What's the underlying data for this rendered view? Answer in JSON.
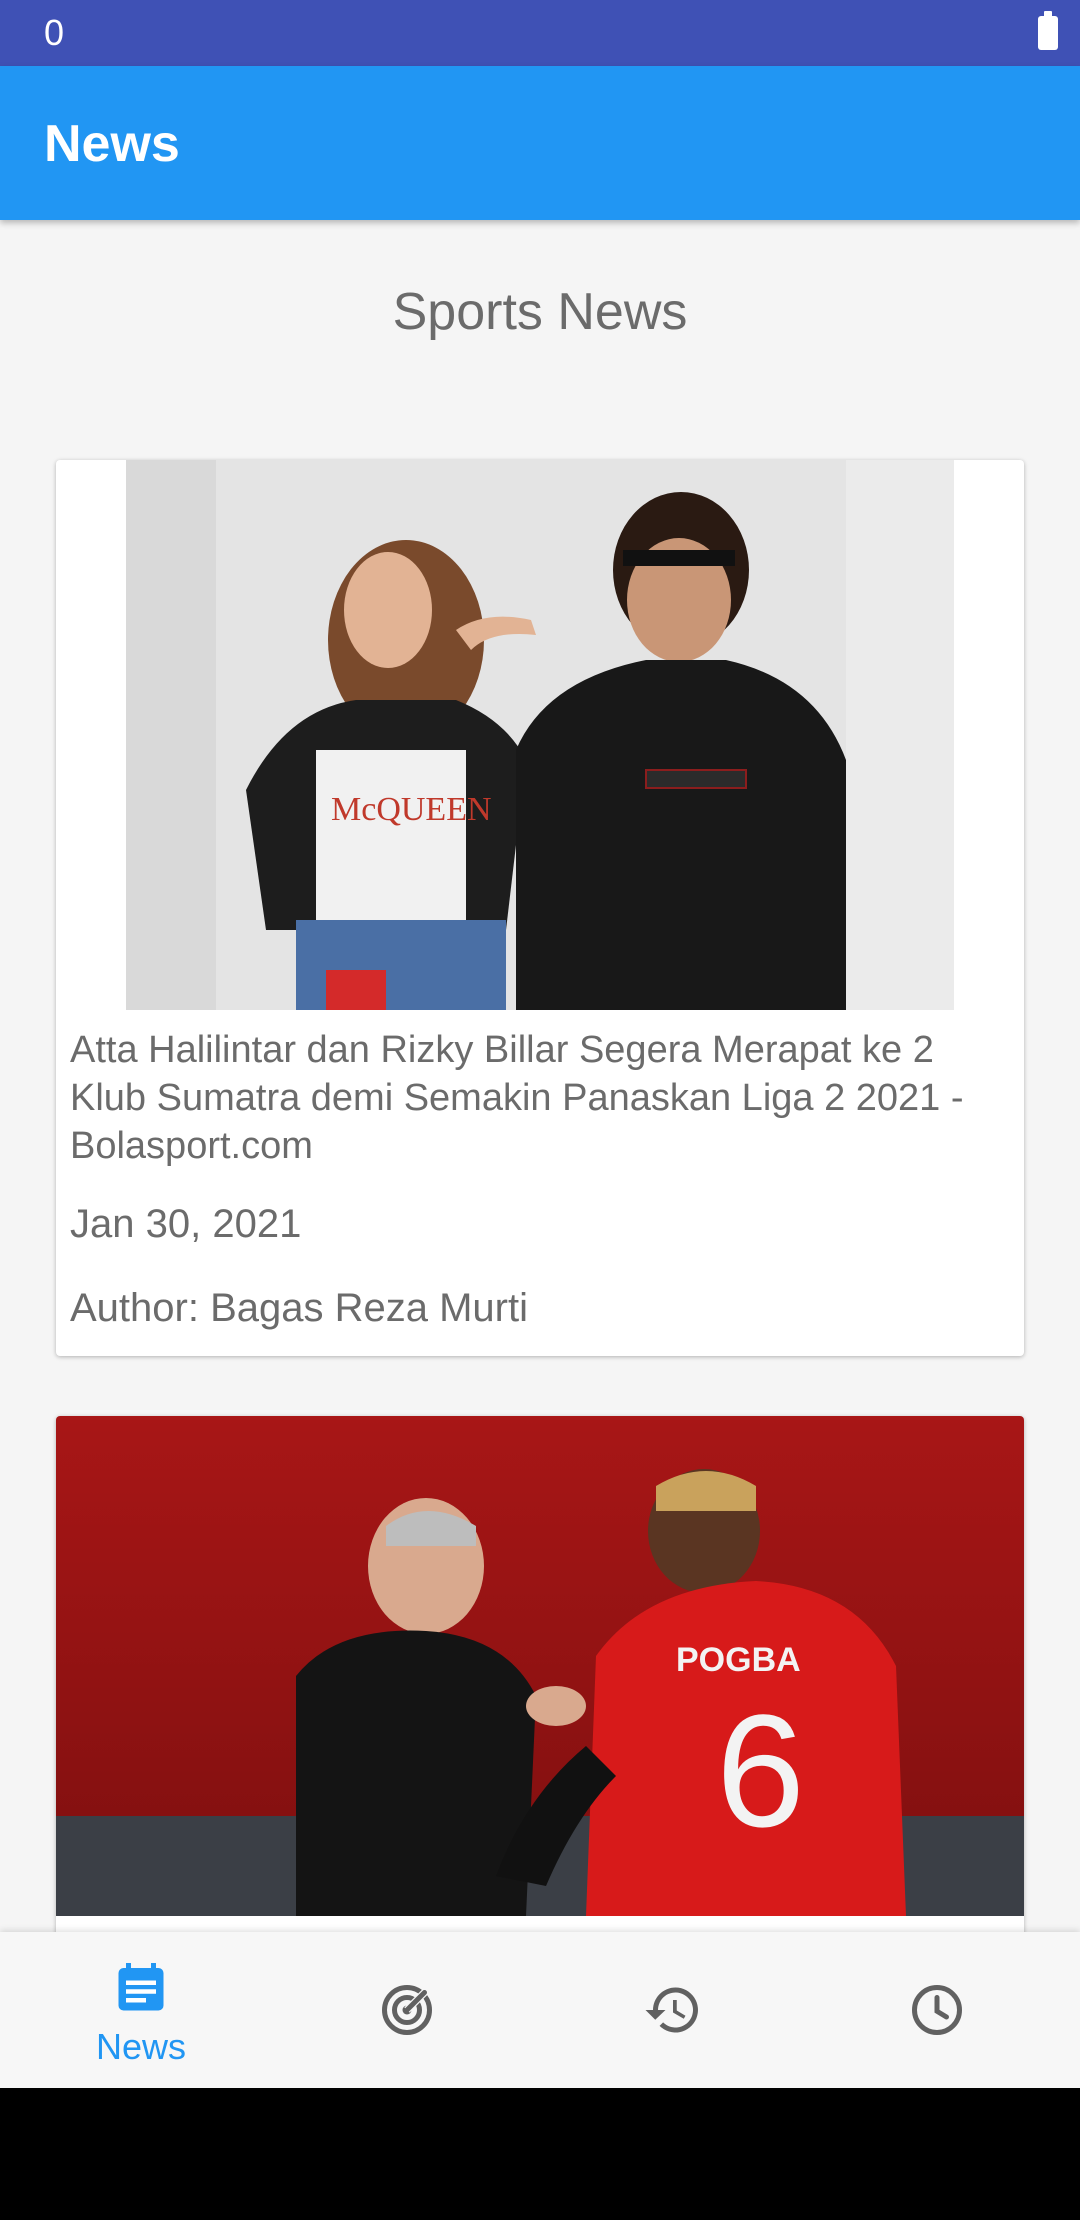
{
  "status_bar": {
    "text": "0",
    "icons": [
      "battery-icon"
    ]
  },
  "app_bar": {
    "title": "News"
  },
  "section": {
    "title": "Sports News"
  },
  "articles": [
    {
      "image_icon": "photo-couple",
      "title": "Atta Halilintar dan Rizky Billar Segera Merapat ke 2 Klub Sumatra demi Semakin Panaskan Liga 2 2021 - Bolasport.com",
      "date": "Jan 30, 2021",
      "author": "Author: Bagas Reza Murti"
    },
    {
      "image_icon": "photo-football"
    }
  ],
  "bottom_nav": {
    "items": [
      {
        "label": "News",
        "icon": "newspaper-icon",
        "selected": true
      },
      {
        "label": "",
        "icon": "radar-icon",
        "selected": false
      },
      {
        "label": "",
        "icon": "history-icon",
        "selected": false
      },
      {
        "label": "",
        "icon": "clock-icon",
        "selected": false
      }
    ],
    "active_color": "#2196f3",
    "inactive_color": "#616161"
  },
  "colors": {
    "status_bar": "#3f51b5",
    "app_bar": "#2196f3",
    "background": "#f5f5f5",
    "text": "#6b6b6b"
  }
}
